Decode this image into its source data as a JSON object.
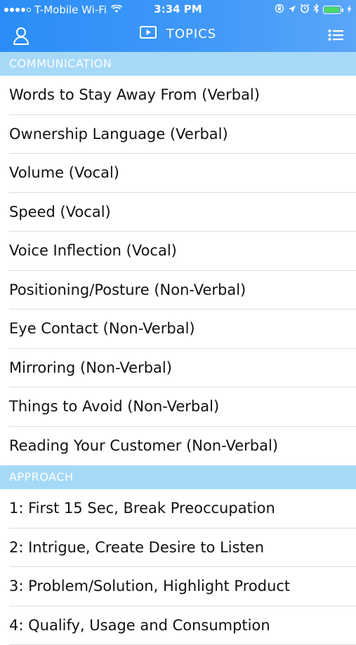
{
  "status_bar": {
    "carrier": "T-Mobile Wi-Fi",
    "time": "3:34 PM",
    "battery_color": "#4cd964"
  },
  "nav": {
    "title": "TOPICS",
    "left_icon": "profile-icon",
    "title_icon": "video-play-icon",
    "right_icon": "list-icon"
  },
  "sections": [
    {
      "header": "COMMUNICATION",
      "items": [
        "Words to Stay Away From (Verbal)",
        "Ownership Language (Verbal)",
        "Volume (Vocal)",
        "Speed (Vocal)",
        "Voice Inflection (Vocal)",
        "Positioning/Posture (Non-Verbal)",
        "Eye Contact (Non-Verbal)",
        "Mirroring (Non-Verbal)",
        "Things to Avoid (Non-Verbal)",
        "Reading Your Customer (Non-Verbal)"
      ]
    },
    {
      "header": "APPROACH",
      "items": [
        "1: First 15 Sec, Break Preoccupation",
        "2: Intrigue, Create Desire to Listen",
        "3: Problem/Solution, Highlight Product",
        "4: Qualify, Usage and Consumption"
      ]
    }
  ],
  "colors": {
    "header_blue": "#2a8df7",
    "section_header_bg": "#a6d9f7"
  }
}
